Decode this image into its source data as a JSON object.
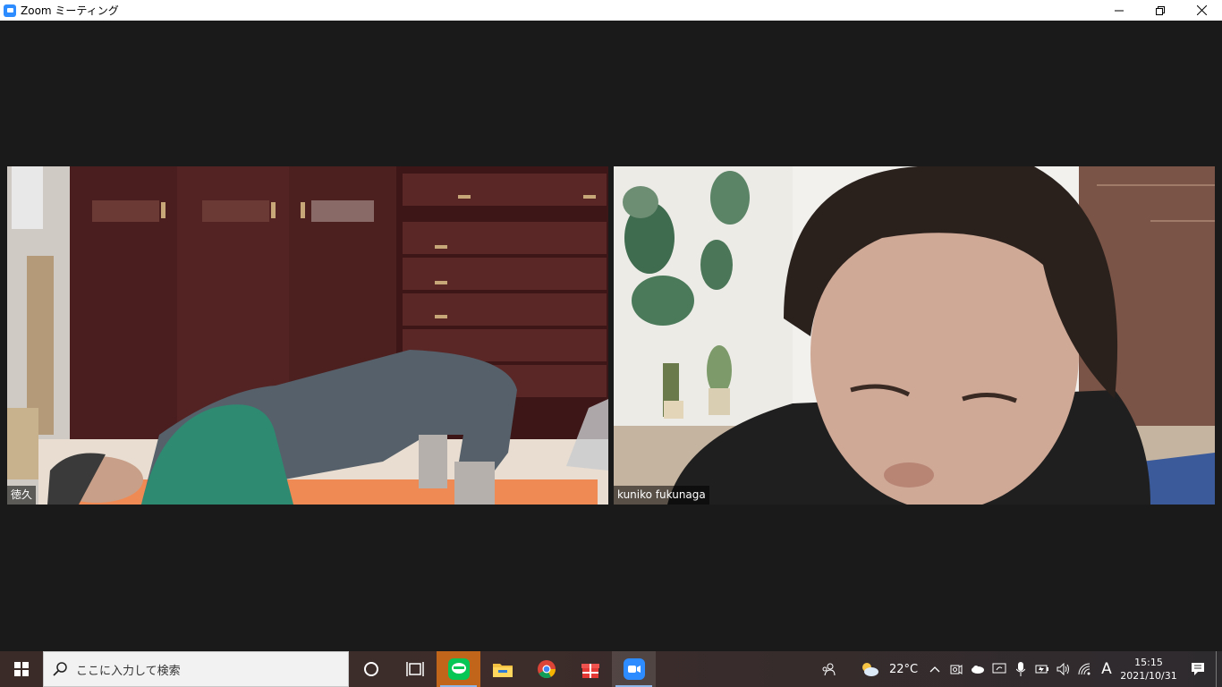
{
  "window": {
    "title": "Zoom ミーティング",
    "controls": {
      "minimize": "—",
      "restore": "❐",
      "close": "✕"
    }
  },
  "participants": [
    {
      "name": "徳久"
    },
    {
      "name": "kuniko fukunaga"
    }
  ],
  "taskbar": {
    "search_placeholder": "ここに入力して検索",
    "apps": [
      "cortana-icon",
      "task-view-icon",
      "line-icon",
      "file-explorer-icon",
      "chrome-icon",
      "gift-app-icon",
      "zoom-icon"
    ],
    "weather": {
      "temp": "22°C"
    },
    "ime": "A",
    "clock": {
      "time": "15:15",
      "date": "2021/10/31"
    }
  },
  "colors": {
    "zoom_blue": "#2D8CFF",
    "line_green": "#06C755",
    "stage_bg": "#1a1a1a"
  }
}
